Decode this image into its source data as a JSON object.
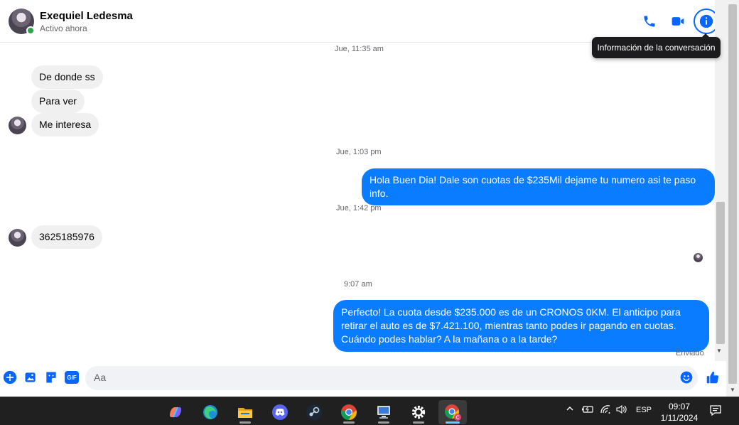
{
  "header": {
    "contact_name": "Exequiel Ledesma",
    "status": "Activo ahora",
    "tooltip": "Información de la conversación",
    "icons": [
      "phone-icon",
      "video-camera-icon",
      "info-icon"
    ]
  },
  "messages": {
    "timestamps": [
      "Jue, 11:35 am",
      "Jue, 1:03 pm",
      "Jue, 1:42 pm",
      "9:07 am"
    ],
    "incoming": [
      "De donde ss",
      "Para ver",
      "Me interesa",
      "3625185976"
    ],
    "outgoing": [
      "Hola Buen Dia! Dale son cuotas de $235Mil dejame tu numero asi te paso info.",
      "Perfecto! La cuota desde $235.000 es de un CRONOS 0KM. El anticipo para retirar el auto es de $7.421.100, mientras tanto podes ir pagando en cuotas. Cuándo podes hablar? A la mañana o a la tarde?"
    ],
    "delivery_status": "Enviado"
  },
  "composer": {
    "placeholder": "Aa",
    "gif_label": "GIF",
    "icons": [
      "plus-icon",
      "photo-icon",
      "sticker-icon",
      "gif-icon",
      "emoji-icon",
      "thumbs-up-icon"
    ]
  },
  "taskbar": {
    "apps": [
      "copilot-icon",
      "edge-icon",
      "file-explorer-icon",
      "discord-icon",
      "steam-icon",
      "chrome-icon",
      "network-pc-icon",
      "settings-icon",
      "chrome-profile-icon"
    ],
    "language": "ESP",
    "time": "09:07",
    "date": "1/11/2024"
  },
  "colors": {
    "accent": "#0866ff",
    "outgoing_bubble": "#0a7cff",
    "incoming_bubble": "#f0f0f0",
    "online": "#31a24c",
    "taskbar": "#202020"
  }
}
